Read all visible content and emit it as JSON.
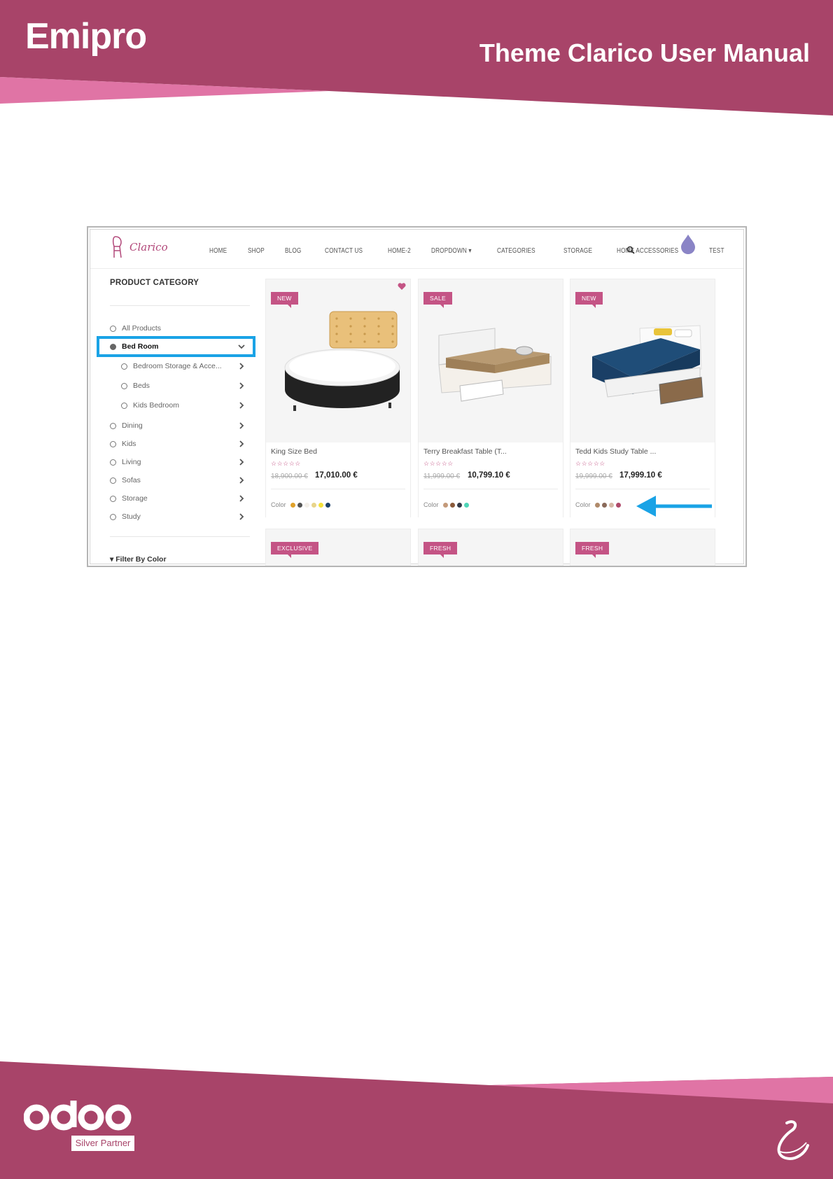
{
  "doc": {
    "brand": "Emipro",
    "manual_title": "Theme Clarico User Manual",
    "footer_logo_text": "odoo",
    "footer_badge": "Silver Partner"
  },
  "colors": {
    "band": "#a84469",
    "band_accent": "#e074a5",
    "highlight": "#1aa3e6",
    "site_accent": "#c45485"
  },
  "site": {
    "logo_text": "Clarico",
    "nav": [
      "HOME",
      "SHOP",
      "BLOG",
      "CONTACT US",
      "HOME-2",
      "DROPDOWN ▾",
      "CATEGORIES",
      "STORAGE",
      "HOME ACCESSORIES",
      "TEST"
    ],
    "search_icon": "search-icon",
    "sidebar": {
      "title": "PRODUCT CATEGORY",
      "categories": [
        {
          "label": "All Products",
          "state": "unselected",
          "chevron": "none"
        },
        {
          "label": "Bed Room",
          "state": "selected",
          "chevron": "down"
        },
        {
          "label": "Bedroom Storage & Acce...",
          "state": "unselected",
          "chevron": "right"
        },
        {
          "label": "Beds",
          "state": "unselected",
          "chevron": "right"
        },
        {
          "label": "Kids Bedroom",
          "state": "unselected",
          "chevron": "right"
        },
        {
          "label": "Dining",
          "state": "unselected",
          "chevron": "right"
        },
        {
          "label": "Kids",
          "state": "unselected",
          "chevron": "right"
        },
        {
          "label": "Living",
          "state": "unselected",
          "chevron": "right"
        },
        {
          "label": "Sofas",
          "state": "unselected",
          "chevron": "right"
        },
        {
          "label": "Storage",
          "state": "unselected",
          "chevron": "right"
        },
        {
          "label": "Study",
          "state": "unselected",
          "chevron": "right"
        }
      ],
      "filter_label": "Filter By Color"
    },
    "products": [
      {
        "badge": "NEW",
        "name": "King Size Bed",
        "old_price": "18,900.00 €",
        "price": "17,010.00 €",
        "rating_stars": "☆☆☆☆☆",
        "color_label": "Color",
        "swatches": [
          "#e0a12a",
          "#555555",
          "#f4f0ea",
          "#e8d48a",
          "#f4e13a",
          "#1d4268"
        ],
        "wishlist": true
      },
      {
        "badge": "SALE",
        "name": "Terry Breakfast Table (T...",
        "old_price": "11,999.00 €",
        "price": "10,799.10 €",
        "rating_stars": "☆☆☆☆☆",
        "color_label": "Color",
        "swatches": [
          "#c49a7a",
          "#8a5a3a",
          "#333a48",
          "#4fd6b8"
        ],
        "wishlist": false
      },
      {
        "badge": "NEW",
        "name": "Tedd Kids Study Table ...",
        "old_price": "19,999.00 €",
        "price": "17,999.10 €",
        "rating_stars": "☆☆☆☆☆",
        "color_label": "Color",
        "swatches": [
          "#b08a6a",
          "#8a6a5a",
          "#d6b8a6",
          "#b04a6a"
        ],
        "wishlist": false
      }
    ],
    "next_row_badges": [
      "EXCLUSIVE",
      "FRESH",
      "FRESH"
    ]
  }
}
